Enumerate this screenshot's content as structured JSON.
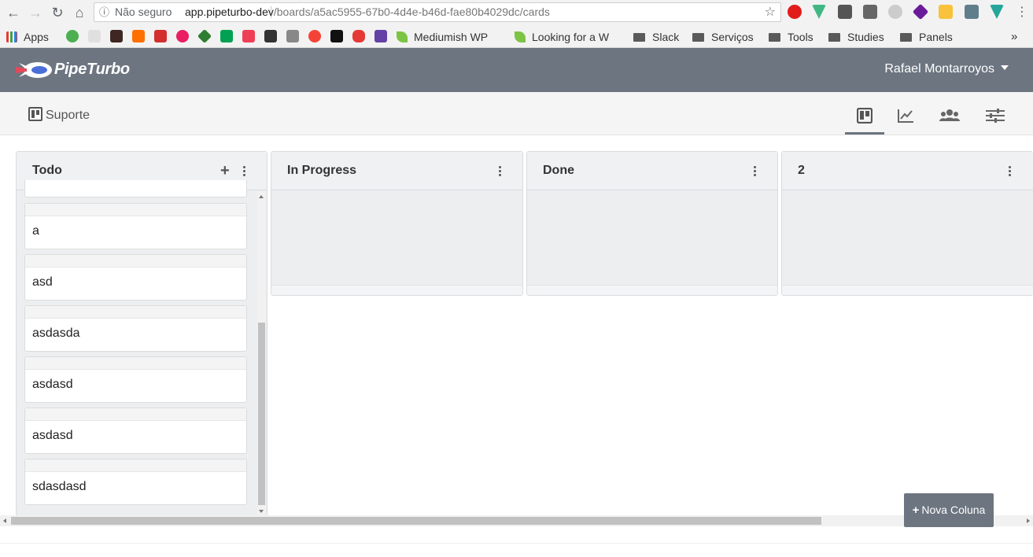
{
  "browser": {
    "insecure_label": "Não seguro",
    "url_host": "app.pipeturbo-dev",
    "url_path": "/boards/a5ac5955-67b0-4d4e-b46d-fae80b4029dc/cards",
    "bookmarks": [
      {
        "label": "Apps"
      },
      {
        "label": "Mediumish WP"
      },
      {
        "label": "Looking for a W"
      },
      {
        "label": "Slack"
      },
      {
        "label": "Serviços"
      },
      {
        "label": "Tools"
      },
      {
        "label": "Studies"
      },
      {
        "label": "Panels"
      }
    ],
    "overflow_label": "»"
  },
  "header": {
    "brand": "PipeTurbo",
    "user_name": "Rafael Montarroyos"
  },
  "toolbar": {
    "board_name": "Suporte",
    "views": [
      "board-view",
      "reports-view",
      "members-view",
      "settings-view"
    ],
    "active_view": "board-view"
  },
  "columns": [
    {
      "title": "Todo",
      "has_add": true,
      "add_label": "+",
      "cards": [
        "a",
        "asd",
        "asdasda",
        "asdasd",
        "asdasd",
        "sdasdasd"
      ]
    },
    {
      "title": "In Progress",
      "has_add": false,
      "cards": []
    },
    {
      "title": "Done",
      "has_add": false,
      "cards": []
    },
    {
      "title": "2",
      "has_add": false,
      "cards": []
    }
  ],
  "new_column_button": {
    "plus": "+",
    "label": "Nova Coluna"
  },
  "colors": {
    "header_bg": "#6c7580",
    "column_bg": "#eceef0",
    "accent": "#6c7580"
  }
}
